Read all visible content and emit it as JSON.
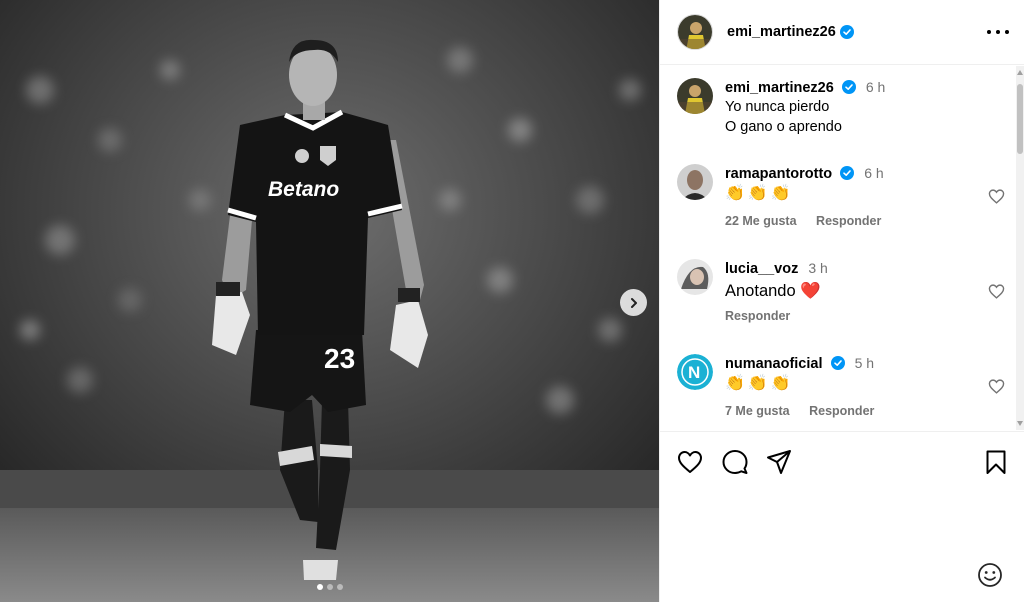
{
  "post": {
    "author": "emi_martinez26",
    "verified": true
  },
  "caption": {
    "username": "emi_martinez26",
    "time": "6 h",
    "line1": "Yo nunca pierdo",
    "line2": "O gano o aprendo"
  },
  "jersey": {
    "sponsor": "Betano",
    "number": "23"
  },
  "comments": [
    {
      "username": "ramapantorotto",
      "verified": true,
      "time": "6 h",
      "text": "👏👏👏",
      "likes": "22 Me gusta",
      "reply": "Responder"
    },
    {
      "username": "lucia__voz",
      "verified": false,
      "time": "3 h",
      "text": "Anotando ❤️",
      "likes": "",
      "reply": "Responder"
    },
    {
      "username": "numanaoficial",
      "verified": true,
      "time": "5 h",
      "text": "👏👏👏",
      "likes": "7 Me gusta",
      "reply": "Responder"
    }
  ],
  "carousel": {
    "total": 3,
    "active": 0
  },
  "icons": {
    "more": "more-icon",
    "next": "chevron-right-icon",
    "like": "heart-icon",
    "comment": "comment-icon",
    "share": "share-icon",
    "save": "bookmark-icon",
    "emoji": "emoji-icon"
  },
  "colors": {
    "verified": "#0095f6",
    "meta": "#737373",
    "heart": "#ed4956",
    "numana": "#1bb1d4"
  }
}
